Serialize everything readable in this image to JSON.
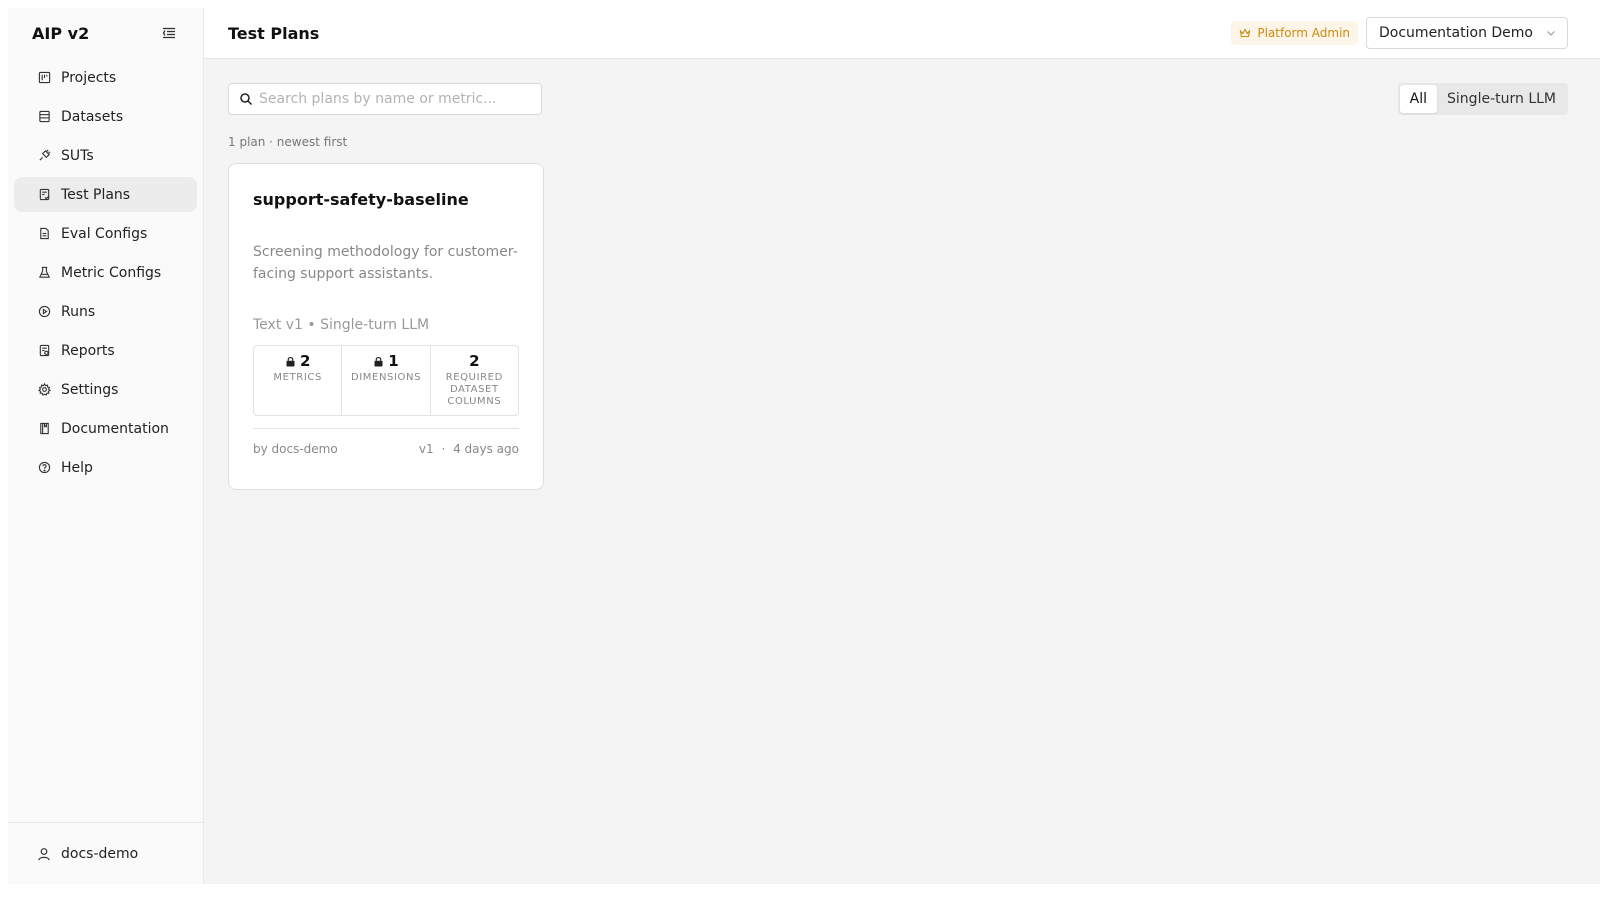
{
  "sidebar": {
    "brand": "AIP v2",
    "items": [
      {
        "label": "Projects",
        "icon": "kanban-icon",
        "active": false
      },
      {
        "label": "Datasets",
        "icon": "database-icon",
        "active": false
      },
      {
        "label": "SUTs",
        "icon": "plug-icon",
        "active": false
      },
      {
        "label": "Test Plans",
        "icon": "clipboard-check-icon",
        "active": true
      },
      {
        "label": "Eval Configs",
        "icon": "file-icon",
        "active": false
      },
      {
        "label": "Metric Configs",
        "icon": "flask-icon",
        "active": false
      },
      {
        "label": "Runs",
        "icon": "play-circle-icon",
        "active": false
      },
      {
        "label": "Reports",
        "icon": "report-icon",
        "active": false
      },
      {
        "label": "Settings",
        "icon": "gear-icon",
        "active": false
      },
      {
        "label": "Documentation",
        "icon": "book-icon",
        "active": false
      },
      {
        "label": "Help",
        "icon": "help-circle-icon",
        "active": false
      }
    ],
    "footer_user": "docs-demo"
  },
  "header": {
    "title": "Test Plans",
    "admin_badge": "Platform Admin",
    "org_select": "Documentation Demo"
  },
  "toolbar": {
    "search_placeholder": "Search plans by name or metric...",
    "filters": [
      {
        "label": "All",
        "active": true
      },
      {
        "label": "Single-turn LLM",
        "active": false
      }
    ]
  },
  "summary": "1 plan · newest first",
  "plans": [
    {
      "title": "support-safety-baseline",
      "description": "Screening methodology for customer-facing support assistants.",
      "meta": "Text v1 • Single-turn LLM",
      "stats": [
        {
          "value": "2",
          "label": "Metrics",
          "locked": true
        },
        {
          "value": "1",
          "label": "Dimensions",
          "locked": true
        },
        {
          "value": "2",
          "label": "Required dataset columns",
          "locked": false
        }
      ],
      "author": "by docs-demo",
      "version": "v1",
      "sep": "·",
      "age": "4 days ago"
    }
  ],
  "colors": {
    "accent_admin": "#c98a10",
    "active_nav_bg": "#ececec",
    "main_bg": "#f4f4f4"
  }
}
